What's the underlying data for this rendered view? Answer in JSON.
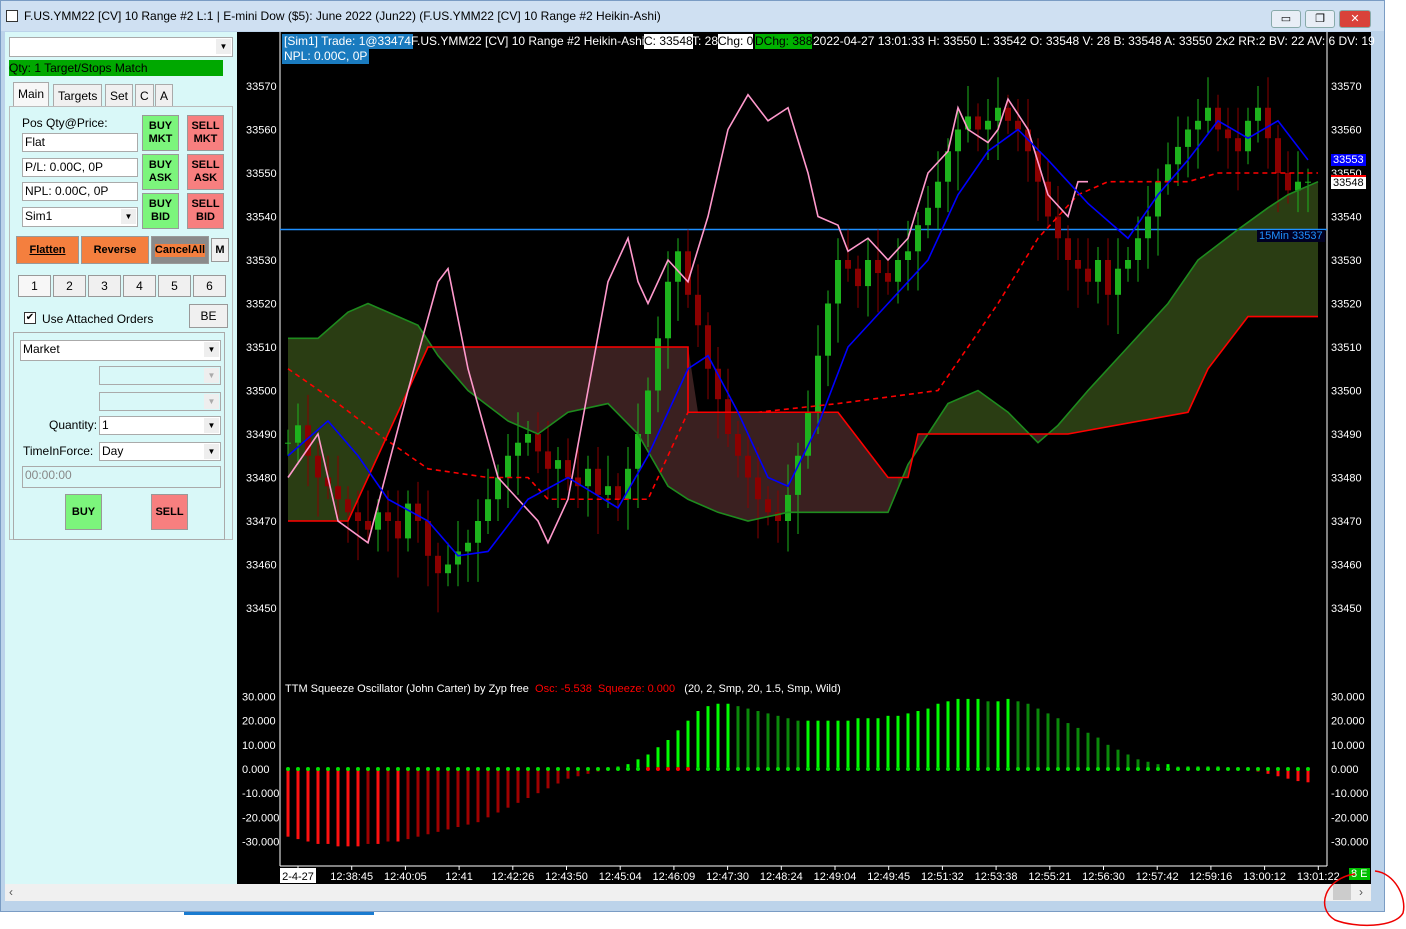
{
  "window": {
    "title": "F.US.YMM22 [CV]  10 Range  #2 L:1 | E-mini Dow ($5): June 2022 (Jun22) (F.US.YMM22 [CV]  10 Range  #2 Heikin-Ashi)",
    "minimize": "▭",
    "maximize": "❐",
    "close": "✕"
  },
  "panel": {
    "account_dropdown": "",
    "status": "Qty: 1 Target/Stops Match",
    "tabs": [
      "Main",
      "Targets",
      "Set",
      "C",
      "A"
    ],
    "pos_label": "Pos Qty@Price:",
    "pos_value": "Flat",
    "pl": "P/L: 0.00C, 0P",
    "npl": "NPL: 0.00C, 0P",
    "account": "Sim1",
    "buy_mkt": "BUY MKT",
    "sell_mkt": "SELL MKT",
    "buy_ask": "BUY ASK",
    "sell_ask": "SELL ASK",
    "buy_bid": "BUY BID",
    "sell_bid": "SELL BID",
    "flatten": "Flatten",
    "reverse": "Reverse",
    "cancel_all": "CancelAll",
    "m": "M",
    "qty_buttons": [
      "1",
      "2",
      "3",
      "4",
      "5",
      "6"
    ],
    "use_attached": "Use Attached Orders",
    "be": "BE",
    "order_type": "Market",
    "quantity_label": "Quantity:",
    "quantity": "1",
    "tif_label": "TimeInForce:",
    "tif": "Day",
    "time": "00:00:00",
    "buy": "BUY",
    "sell": "SELL"
  },
  "info": {
    "sim": "[Sim1]  Trade: 1@33474",
    "symbol": "F.US.YMM22 [CV]  10 Range  #2 Heikin-Ashi",
    "c": "C: 33548",
    "t": "T: 28",
    "chg": "Chg: 0",
    "dchg": "DChg: 388",
    "rest": "2022-04-27 13:01:33 H: 33550 L: 33542 O: 33548 V: 28 B: 33548 A: 33550 2x2 RR:2 BV: 22 AV: 6 DV: 19",
    "npl": "NPL: 0.00C, 0P"
  },
  "osc_title": "TTM Squeeze Oscillator (John Carter) by Zyp free",
  "osc_val": "Osc: -5.538",
  "squeeze_val": "Squeeze: 0.000",
  "osc_params": "(20, 2, Smp, 20, 1.5, Smp, Wild)",
  "marker_15min": "15Min  33537",
  "price_tag_blue": "33553",
  "price_tag_last": "33548",
  "corner_tag": "8 E",
  "colors": {
    "up": "#1db31d",
    "down": "#8b0000",
    "blue": "#0000ff",
    "pink": "#ff99cc",
    "red": "#ff0000",
    "cloud_green": "#2a3d13",
    "cloud_red": "#3a2020"
  },
  "chart_data": [
    {
      "type": "candlestick",
      "title": "F.US.YMM22 10 Range Heikin-Ashi",
      "ylim": [
        33440,
        33575
      ],
      "yticks": [
        33570,
        33560,
        33550,
        33540,
        33530,
        33520,
        33510,
        33500,
        33490,
        33480,
        33470,
        33460,
        33450
      ],
      "xticks": [
        "2-4-27",
        "12:38:45",
        "12:40:05",
        "12:41",
        "12:42:26",
        "12:43:50",
        "12:45:04",
        "12:46:09",
        "12:47:30",
        "12:48:24",
        "12:49:04",
        "12:49:45",
        "12:51:32",
        "12:53:38",
        "12:55:21",
        "12:56:30",
        "12:57:42",
        "12:59:16",
        "13:00:12",
        "13:01:22"
      ],
      "closes": [
        33488,
        33492,
        33485,
        33480,
        33478,
        33475,
        33472,
        33470,
        33468,
        33472,
        33470,
        33466,
        33474,
        33470,
        33462,
        33458,
        33460,
        33463,
        33465,
        33470,
        33475,
        33480,
        33485,
        33488,
        33490,
        33486,
        33482,
        33484,
        33480,
        33478,
        33482,
        33476,
        33478,
        33475,
        33482,
        33490,
        33500,
        33512,
        33525,
        33532,
        33522,
        33515,
        33505,
        33498,
        33490,
        33485,
        33480,
        33475,
        33472,
        33470,
        33476,
        33485,
        33495,
        33508,
        33520,
        33530,
        33528,
        33524,
        33530,
        33527,
        33525,
        33530,
        33532,
        33538,
        33542,
        33548,
        33555,
        33560,
        33563,
        33560,
        33562,
        33565,
        33562,
        33560,
        33555,
        33548,
        33540,
        33535,
        33530,
        33528,
        33525,
        33530,
        33522,
        33528,
        33530,
        33535,
        33540,
        33548,
        33552,
        33556,
        33560,
        33562,
        33565,
        33560,
        33558,
        33555,
        33562,
        33565,
        33558,
        33550,
        33546,
        33548,
        33548
      ],
      "horizontal_line": 33537,
      "lines": {
        "blue": [
          [
            0,
            33485
          ],
          [
            4,
            33493
          ],
          [
            7,
            33485
          ],
          [
            10,
            33475
          ],
          [
            14,
            33470
          ],
          [
            17,
            33462
          ],
          [
            20,
            33463
          ],
          [
            24,
            33475
          ],
          [
            28,
            33480
          ],
          [
            33,
            33473
          ],
          [
            36,
            33485
          ],
          [
            40,
            33505
          ],
          [
            42,
            33508
          ],
          [
            45,
            33495
          ],
          [
            48,
            33480
          ],
          [
            50,
            33478
          ],
          [
            53,
            33492
          ],
          [
            56,
            33510
          ],
          [
            60,
            33520
          ],
          [
            64,
            33530
          ],
          [
            67,
            33545
          ],
          [
            70,
            33555
          ],
          [
            73,
            33560
          ],
          [
            76,
            33553
          ],
          [
            80,
            33543
          ],
          [
            84,
            33535
          ],
          [
            87,
            33545
          ],
          [
            90,
            33553
          ],
          [
            93,
            33562
          ],
          [
            96,
            33558
          ],
          [
            99,
            33562
          ],
          [
            102,
            33553
          ]
        ],
        "pink": [
          [
            0,
            33480
          ],
          [
            3,
            33490
          ],
          [
            5,
            33470
          ],
          [
            8,
            33465
          ],
          [
            12,
            33500
          ],
          [
            15,
            33525
          ],
          [
            16,
            33528
          ],
          [
            18,
            33505
          ],
          [
            21,
            33480
          ],
          [
            23,
            33475
          ],
          [
            25,
            33470
          ],
          [
            26,
            33465
          ],
          [
            28,
            33475
          ],
          [
            30,
            33500
          ],
          [
            32,
            33525
          ],
          [
            34,
            33535
          ],
          [
            35,
            33525
          ],
          [
            36,
            33520
          ],
          [
            38,
            33530
          ],
          [
            40,
            33525
          ],
          [
            42,
            33540
          ],
          [
            44,
            33560
          ],
          [
            46,
            33568
          ],
          [
            48,
            33562
          ],
          [
            50,
            33565
          ],
          [
            52,
            33550
          ],
          [
            53,
            33540
          ],
          [
            55,
            33538
          ],
          [
            56,
            33532
          ],
          [
            58,
            33535
          ],
          [
            60,
            33530
          ],
          [
            62,
            33535
          ],
          [
            64,
            33550
          ],
          [
            66,
            33555
          ],
          [
            67,
            33565
          ],
          [
            68,
            33560
          ],
          [
            70,
            33557
          ],
          [
            71,
            33560
          ],
          [
            72,
            33567
          ],
          [
            74,
            33560
          ],
          [
            76,
            33545
          ],
          [
            78,
            33540
          ],
          [
            79,
            33548
          ],
          [
            80,
            33548
          ]
        ],
        "red_dashed": [
          [
            0,
            33505
          ],
          [
            5,
            33497
          ],
          [
            9,
            33490
          ],
          [
            14,
            33482
          ],
          [
            20,
            33480
          ],
          [
            24,
            33480
          ],
          [
            26,
            33475
          ],
          [
            36,
            33475
          ],
          [
            38,
            33485
          ],
          [
            40,
            33495
          ],
          [
            47,
            33495
          ],
          [
            55,
            33497
          ],
          [
            65,
            33500
          ],
          [
            68,
            33510
          ],
          [
            71,
            33520
          ],
          [
            75,
            33535
          ],
          [
            79,
            33545
          ],
          [
            82,
            33548
          ],
          [
            90,
            33548
          ],
          [
            93,
            33550
          ],
          [
            103,
            33550
          ]
        ],
        "red_solid": [
          [
            0,
            33470
          ],
          [
            6,
            33470
          ],
          [
            14,
            33510
          ],
          [
            40,
            33510
          ],
          [
            40,
            33495
          ],
          [
            55,
            33495
          ],
          [
            60,
            33480
          ],
          [
            62,
            33480
          ],
          [
            63,
            33490
          ],
          [
            78,
            33490
          ],
          [
            90,
            33495
          ],
          [
            92,
            33505
          ],
          [
            96,
            33517
          ],
          [
            103,
            33517
          ]
        ],
        "green": [
          [
            0,
            33512
          ],
          [
            3,
            33512
          ],
          [
            6,
            33518
          ],
          [
            8,
            33520
          ],
          [
            13,
            33515
          ],
          [
            15,
            33508
          ],
          [
            18,
            33500
          ],
          [
            22,
            33493
          ],
          [
            25,
            33490
          ],
          [
            28,
            33495
          ],
          [
            32,
            33497
          ],
          [
            35,
            33490
          ],
          [
            38,
            33478
          ],
          [
            40,
            33475
          ],
          [
            43,
            33472
          ],
          [
            46,
            33470
          ],
          [
            50,
            33472
          ],
          [
            55,
            33472
          ],
          [
            60,
            33472
          ],
          [
            62,
            33483
          ],
          [
            66,
            33497
          ],
          [
            69,
            33500
          ],
          [
            72,
            33495
          ],
          [
            75,
            33488
          ],
          [
            77,
            33492
          ],
          [
            80,
            33500
          ],
          [
            84,
            33510
          ],
          [
            88,
            33520
          ],
          [
            91,
            33530
          ],
          [
            95,
            33537
          ],
          [
            98,
            33542
          ],
          [
            100,
            33545
          ],
          [
            103,
            33548
          ]
        ]
      }
    },
    {
      "type": "bar",
      "title": "TTM Squeeze Oscillator",
      "ylim": [
        -36,
        34
      ],
      "yticks": [
        "30.000",
        "20.000",
        "10.000",
        "0.000",
        "-10.000",
        "-20.000",
        "-30.000"
      ],
      "values": [
        -28,
        -29,
        -30,
        -31,
        -31,
        -32,
        -32,
        -32,
        -31,
        -31,
        -30,
        -30,
        -29,
        -28,
        -27,
        -26,
        -25,
        -24,
        -23,
        -22,
        -20,
        -18,
        -16,
        -14,
        -12,
        -10,
        -8,
        -6,
        -4,
        -3,
        -2,
        -1,
        -0.5,
        1,
        2,
        4,
        6,
        9,
        12,
        16,
        20,
        24,
        26,
        27,
        27,
        26,
        25,
        24,
        23,
        22,
        21,
        20,
        20,
        20,
        20,
        20,
        20,
        21,
        21,
        21,
        22,
        22,
        23,
        24,
        25,
        27,
        28,
        29,
        29,
        29,
        28,
        28,
        29,
        28,
        27,
        25,
        23,
        21,
        19,
        17,
        15,
        13,
        10,
        8,
        6,
        4,
        3,
        2,
        2,
        1,
        1,
        1,
        1,
        1,
        0.5,
        0.5,
        0.5,
        -1,
        -2,
        -3,
        -4,
        -5,
        -5.5
      ]
    }
  ]
}
